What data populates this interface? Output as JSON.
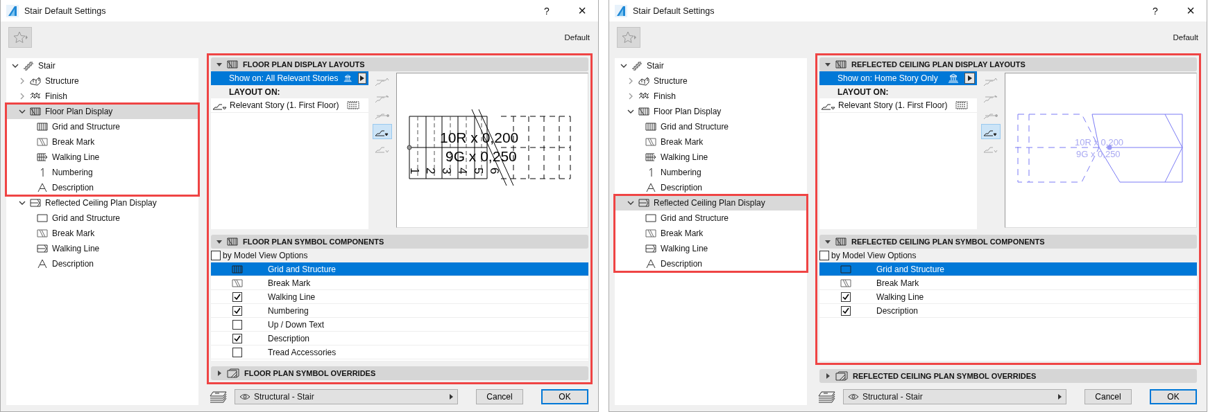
{
  "dialogs": [
    {
      "title": "Stair Default Settings",
      "help": "?",
      "close": "×",
      "favorite_name": "Default",
      "tree": [
        {
          "label": "Stair",
          "kind": "stair",
          "expanded": true,
          "selected": false,
          "children": [
            {
              "label": "Structure",
              "kind": "structure",
              "expanded": false,
              "selected": false
            },
            {
              "label": "Finish",
              "kind": "finish",
              "expanded": false,
              "selected": false
            },
            {
              "label": "Floor Plan Display",
              "kind": "plan",
              "expanded": true,
              "selected": true,
              "highlighted": true,
              "children": [
                {
                  "label": "Grid and Structure",
                  "kind": "grid",
                  "selected": false
                },
                {
                  "label": "Break Mark",
                  "kind": "break",
                  "selected": false
                },
                {
                  "label": "Walking Line",
                  "kind": "walking",
                  "selected": false
                },
                {
                  "label": "Numbering",
                  "kind": "numbering",
                  "selected": false
                },
                {
                  "label": "Description",
                  "kind": "description",
                  "selected": false
                }
              ]
            },
            {
              "label": "Reflected Ceiling Plan Display",
              "kind": "ceiling",
              "expanded": true,
              "selected": false,
              "children": [
                {
                  "label": "Grid and Structure",
                  "kind": "ceilinggrid",
                  "selected": false
                },
                {
                  "label": "Break Mark",
                  "kind": "ceilingbreak",
                  "selected": false
                },
                {
                  "label": "Walking Line",
                  "kind": "ceilingwalking",
                  "selected": false
                },
                {
                  "label": "Description",
                  "kind": "description",
                  "selected": false
                }
              ]
            }
          ]
        }
      ],
      "sections": [
        {
          "kind": "layouts",
          "title": "FLOOR PLAN DISPLAY LAYOUTS",
          "expanded": true,
          "highlighted": true,
          "show_on": "Show on: All Relevant Stories",
          "layout_heading": "LAYOUT ON:",
          "layout_row": "Relevant Story (1. First Floor)",
          "tools": [
            {
              "kind": "up",
              "selected": false
            },
            {
              "kind": "arrow",
              "selected": false
            },
            {
              "kind": "dot",
              "selected": false
            },
            {
              "kind": "menu",
              "selected": true
            },
            {
              "kind": "down",
              "selected": false
            }
          ],
          "preview": {
            "kind": "stair",
            "lines": [
              "10R x 0,200",
              "9G x 0,250"
            ],
            "numbers": [
              "1",
              "2",
              "3",
              "4",
              "5",
              "6"
            ]
          }
        },
        {
          "kind": "components",
          "title": "FLOOR PLAN SYMBOL COMPONENTS",
          "expanded": true,
          "highlighted": true,
          "model_view": {
            "label": "by Model View Options",
            "checked": false
          },
          "rows": [
            {
              "label": "Grid and Structure",
              "kind": "grid",
              "selected": true
            },
            {
              "label": "Break Mark",
              "kind": "break",
              "selected": false
            },
            {
              "label": "Walking Line",
              "kind": "checkbox",
              "checked": true,
              "selected": false
            },
            {
              "label": "Numbering",
              "kind": "checkbox",
              "checked": true,
              "selected": false
            },
            {
              "label": "Up / Down Text",
              "kind": "checkbox",
              "checked": false,
              "selected": false
            },
            {
              "label": "Description",
              "kind": "checkbox",
              "checked": true,
              "selected": false
            },
            {
              "label": "Tread Accessories",
              "kind": "checkbox",
              "checked": false,
              "selected": false
            }
          ]
        },
        {
          "kind": "overrides",
          "title": "FLOOR PLAN SYMBOL OVERRIDES",
          "expanded": false,
          "highlighted": true
        }
      ],
      "footer": {
        "view": "Structural - Stair",
        "cancel": "Cancel",
        "ok": "OK"
      }
    },
    {
      "title": "Stair Default Settings",
      "help": "?",
      "close": "×",
      "favorite_name": "Default",
      "tree": [
        {
          "label": "Stair",
          "kind": "stair",
          "expanded": true,
          "selected": false,
          "children": [
            {
              "label": "Structure",
              "kind": "structure",
              "expanded": false,
              "selected": false
            },
            {
              "label": "Finish",
              "kind": "finish",
              "expanded": false,
              "selected": false
            },
            {
              "label": "Floor Plan Display",
              "kind": "plan",
              "expanded": true,
              "selected": false,
              "children": [
                {
                  "label": "Grid and Structure",
                  "kind": "grid",
                  "selected": false
                },
                {
                  "label": "Break Mark",
                  "kind": "break",
                  "selected": false
                },
                {
                  "label": "Walking Line",
                  "kind": "walking",
                  "selected": false
                },
                {
                  "label": "Numbering",
                  "kind": "numbering",
                  "selected": false
                },
                {
                  "label": "Description",
                  "kind": "description",
                  "selected": false
                }
              ]
            },
            {
              "label": "Reflected Ceiling Plan Display",
              "kind": "ceiling",
              "expanded": true,
              "selected": true,
              "highlighted": true,
              "children": [
                {
                  "label": "Grid and Structure",
                  "kind": "ceilinggrid",
                  "selected": false
                },
                {
                  "label": "Break Mark",
                  "kind": "ceilingbreak",
                  "selected": false
                },
                {
                  "label": "Walking Line",
                  "kind": "ceilingwalking",
                  "selected": false
                },
                {
                  "label": "Description",
                  "kind": "description",
                  "selected": false
                }
              ]
            }
          ]
        }
      ],
      "sections": [
        {
          "kind": "layouts",
          "title": "REFLECTED CEILING PLAN DISPLAY LAYOUTS",
          "expanded": true,
          "highlighted": true,
          "show_on": "Show on: Home Story Only",
          "layout_heading": "LAYOUT ON:",
          "layout_row": "Relevant Story (1. First Floor)",
          "tools": [
            {
              "kind": "up",
              "selected": false
            },
            {
              "kind": "arrow",
              "selected": false
            },
            {
              "kind": "dot",
              "selected": false
            },
            {
              "kind": "menu",
              "selected": true
            },
            {
              "kind": "down",
              "selected": false
            }
          ],
          "preview": {
            "kind": "ceiling",
            "lines": [
              "10R x 0,200",
              "9G x 0,250"
            ]
          }
        },
        {
          "kind": "components",
          "title": "REFLECTED CEILING PLAN SYMBOL COMPONENTS",
          "expanded": true,
          "highlighted": true,
          "model_view": {
            "label": "by Model View Options",
            "checked": false
          },
          "rows": [
            {
              "label": "Grid and Structure",
              "kind": "ceilinggrid",
              "selected": true
            },
            {
              "label": "Break Mark",
              "kind": "ceilingbreak",
              "selected": false
            },
            {
              "label": "Walking Line",
              "kind": "checkbox",
              "checked": true,
              "selected": false
            },
            {
              "label": "Description",
              "kind": "checkbox",
              "checked": true,
              "selected": false
            }
          ]
        },
        {
          "kind": "overrides",
          "title": "REFLECTED CEILING PLAN SYMBOL OVERRIDES",
          "expanded": false,
          "highlighted": false
        }
      ],
      "footer": {
        "view": "Structural - Stair",
        "cancel": "Cancel",
        "ok": "OK"
      }
    }
  ]
}
